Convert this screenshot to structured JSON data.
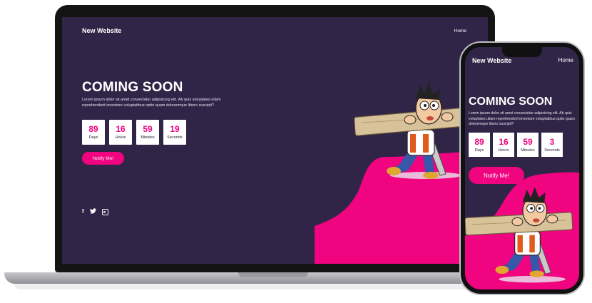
{
  "site": {
    "brand": "New Website",
    "nav_home": "Home",
    "title": "COMING SOON",
    "description": "Lorem ipsum dolor sit amet consectetur adipisicing elit. Ab quis voluptates ullam reprehenderit inventore voluptatibus optio quam doloremque libero suscipit?",
    "notify_label": "Notify Me!"
  },
  "laptop_countdown": [
    {
      "value": "89",
      "label": "Days"
    },
    {
      "value": "16",
      "label": "Hours"
    },
    {
      "value": "59",
      "label": "Minutes"
    },
    {
      "value": "19",
      "label": "Seconds"
    }
  ],
  "phone_countdown": [
    {
      "value": "89",
      "label": "Days"
    },
    {
      "value": "16",
      "label": "Hours"
    },
    {
      "value": "59",
      "label": "Minutes"
    },
    {
      "value": "3",
      "label": "Seconds"
    }
  ],
  "social": {
    "facebook": "f",
    "twitter_icon": "twitter-icon",
    "instagram_icon": "instagram-icon"
  },
  "colors": {
    "background": "#302547",
    "accent": "#f0047f",
    "text": "#ffffff"
  }
}
